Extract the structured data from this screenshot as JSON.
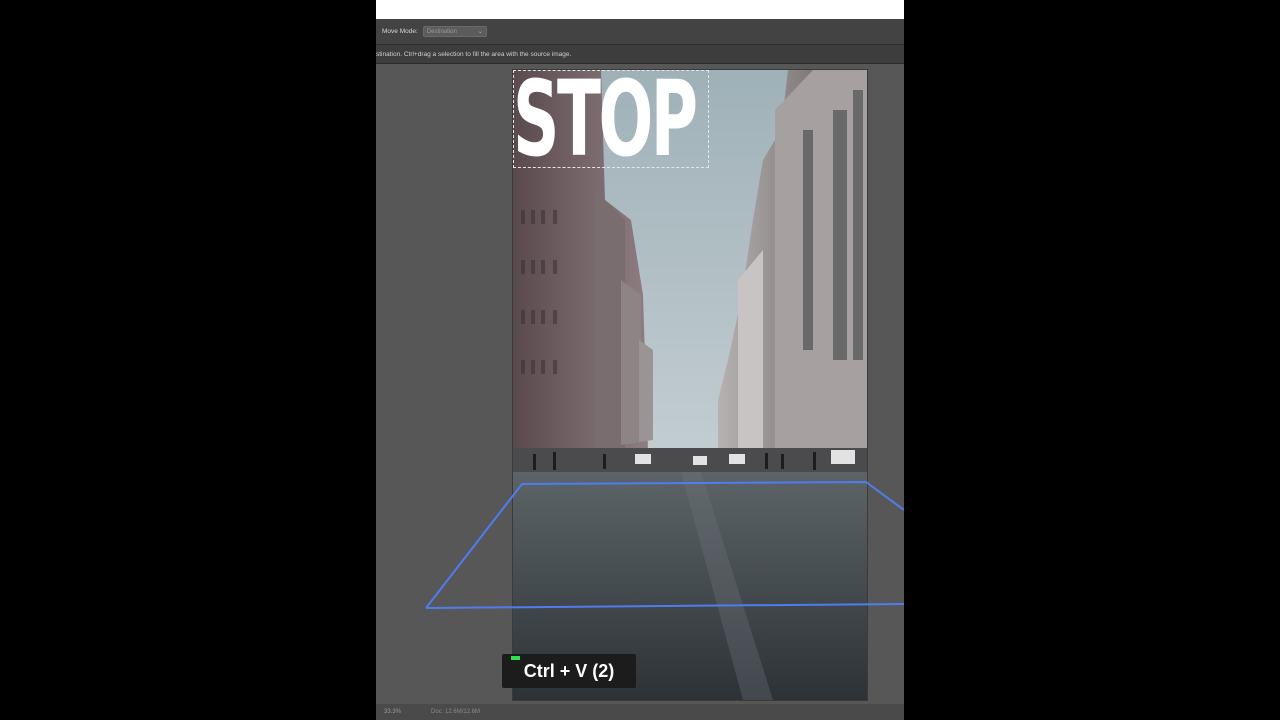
{
  "options_bar": {
    "move_mode_label": "Move Mode:",
    "move_mode_value": "Destination"
  },
  "hint": {
    "text": "stination. Ctrl+drag a selection to fill the area with the source image."
  },
  "document": {
    "overlay_text": "STOP"
  },
  "status_bar": {
    "zoom": "33.3%",
    "info": "Doc: 12.6M/12.6M"
  },
  "shortcut": {
    "text": "Ctrl + V (2)"
  },
  "colors": {
    "perspective_grid": "#4f7df0",
    "indicator": "#2ee04a"
  }
}
